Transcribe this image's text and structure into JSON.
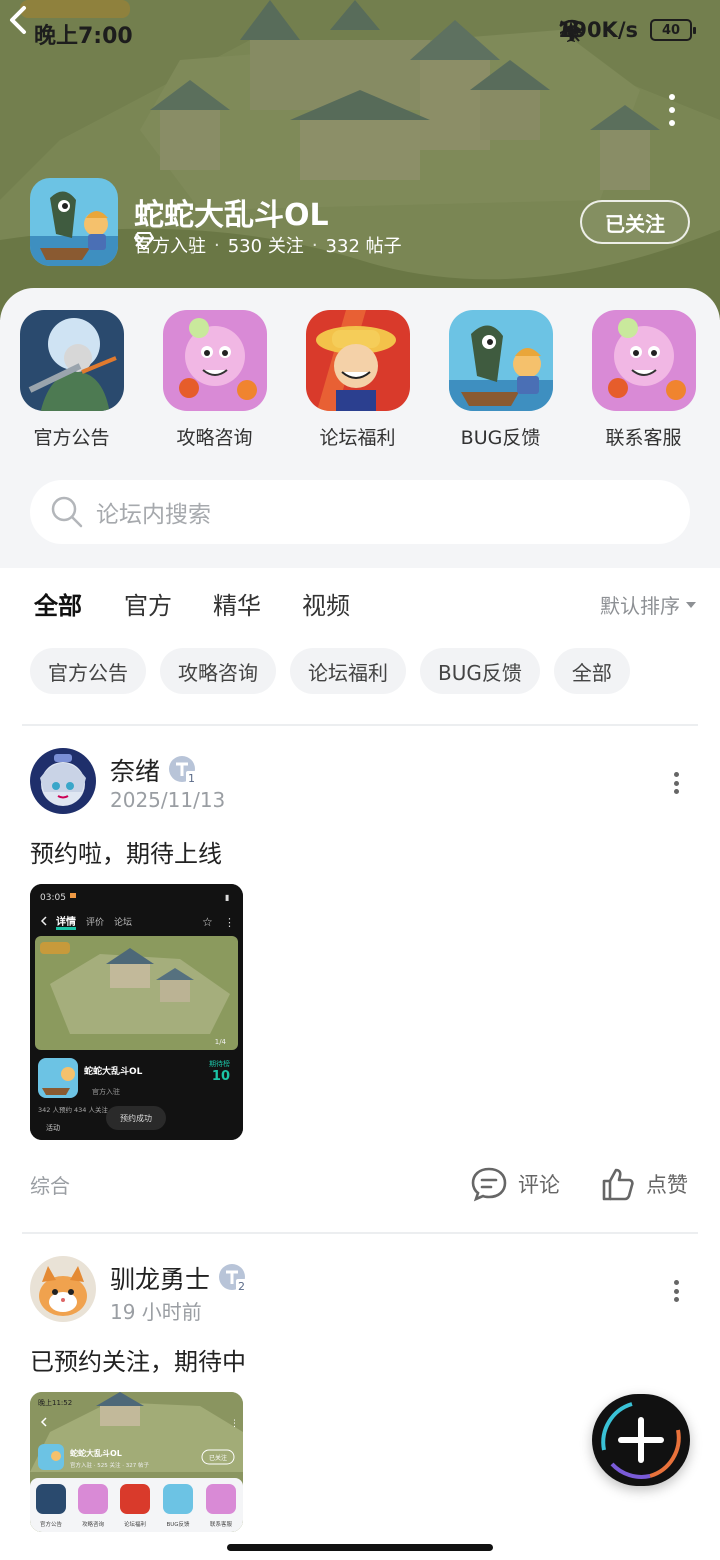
{
  "status_bar": {
    "time": "晚上7:00",
    "net_speed": "190K/s",
    "battery": "40"
  },
  "game": {
    "name": "蛇蛇大乱斗OL",
    "official_label": "官方入驻",
    "follow_count": "530 关注",
    "post_count": "332 帖子",
    "follow_button": "已关注"
  },
  "shortcuts": [
    {
      "label": "官方公告",
      "icon": "announcement-art-icon"
    },
    {
      "label": "攻略咨询",
      "icon": "guide-art-icon"
    },
    {
      "label": "论坛福利",
      "icon": "welfare-art-icon"
    },
    {
      "label": "BUG反馈",
      "icon": "bug-art-icon"
    },
    {
      "label": "联系客服",
      "icon": "service-art-icon"
    }
  ],
  "search": {
    "placeholder": "论坛内搜索"
  },
  "tabs": [
    {
      "label": "全部",
      "active": true
    },
    {
      "label": "官方",
      "active": false
    },
    {
      "label": "精华",
      "active": false
    },
    {
      "label": "视频",
      "active": false
    }
  ],
  "sort_label": "默认排序",
  "chips": [
    "官方公告",
    "攻略咨询",
    "论坛福利",
    "BUG反馈",
    "全部"
  ],
  "posts": [
    {
      "username": "奈绪",
      "badge_level": "1",
      "date": "2025/11/13",
      "content": "预约啦，期待上线",
      "category": "综合",
      "comment_label": "评论",
      "like_label": "点赞",
      "thumb": {
        "time": "03:05",
        "tabs": [
          "详情",
          "评价",
          "论坛"
        ],
        "game_name": "蛇蛇大乱斗OL",
        "official": "官方入驻",
        "rank_label": "期待榜",
        "rank_value": "10",
        "stats": "342 人预约   434 人关注",
        "activity": "活动",
        "reserved_button": "预约成功",
        "page_indicator": "1/4"
      }
    },
    {
      "username": "驯龙勇士",
      "badge_level": "2",
      "date": "19 小时前",
      "content": "已预约关注，期待中",
      "thumb": {
        "time": "晚上11:52",
        "game_name": "蛇蛇大乱斗OL",
        "meta": "官方入驻 · 525 关注 · 327 帖子",
        "follow": "已关注",
        "labels": [
          "官方公告",
          "攻略咨询",
          "论坛福利",
          "BUG反馈",
          "联系客服"
        ]
      }
    }
  ],
  "colors": {
    "accent": "#1cc4a7",
    "hero_green": "#7f8b57",
    "panel_bg": "#f4f5f7"
  }
}
